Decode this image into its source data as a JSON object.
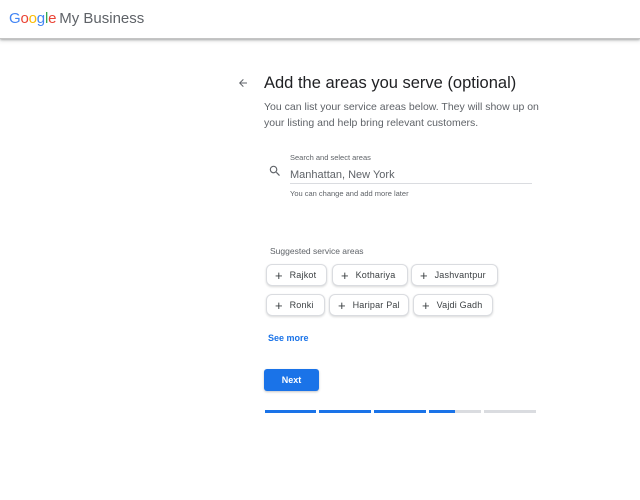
{
  "header": {
    "logo_letters": [
      "G",
      "o",
      "o",
      "g",
      "l",
      "e"
    ],
    "product_name": "My Business"
  },
  "page": {
    "back_icon": "arrow-back-icon",
    "title": "Add the areas you serve (optional)",
    "subtitle": "You can list your service areas below. They will show up on your listing and help bring relevant customers."
  },
  "search": {
    "icon": "search-icon",
    "label": "Search and select areas",
    "value": "Manhattan, New York",
    "hint": "You can change and add more later"
  },
  "suggestions": {
    "label": "Suggested service areas",
    "chips": [
      {
        "label": "Rajkot"
      },
      {
        "label": "Kothariya"
      },
      {
        "label": "Jashvantpur"
      },
      {
        "label": "Ronki"
      },
      {
        "label": "Haripar Pal"
      },
      {
        "label": "Vajdi Gadh"
      }
    ],
    "see_more_label": "See more"
  },
  "actions": {
    "next_label": "Next"
  },
  "progress": {
    "segments": [
      1,
      1,
      1,
      0.5,
      0
    ],
    "accent_color": "#1a73e8"
  }
}
